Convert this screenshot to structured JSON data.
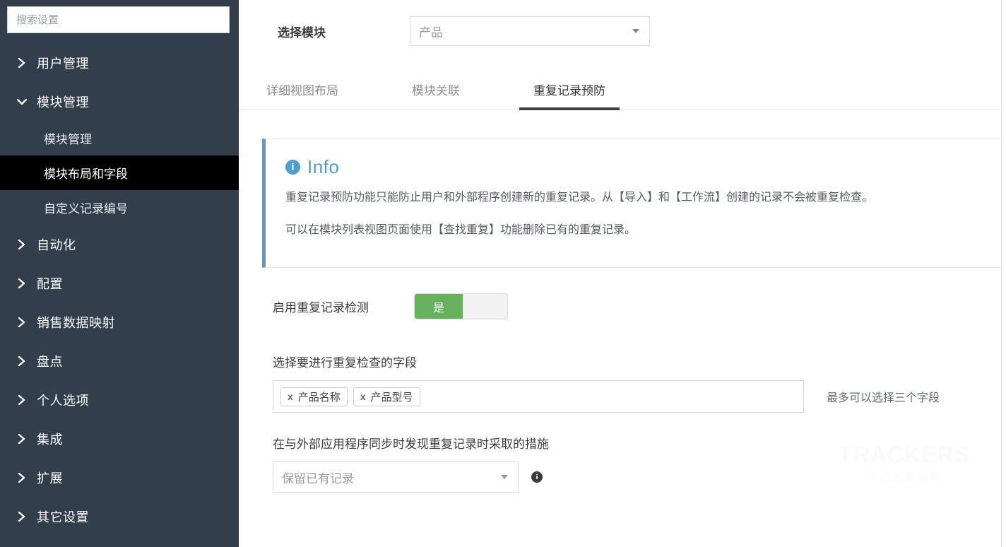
{
  "sidebar": {
    "search": {
      "placeholder": "搜索设置",
      "value": ""
    },
    "items": [
      {
        "label": "用户管理",
        "icon": "chevron-right-icon",
        "expanded": false
      },
      {
        "label": "模块管理",
        "icon": "chevron-down-icon",
        "expanded": true
      },
      {
        "label": "自动化",
        "icon": "chevron-right-icon",
        "expanded": false
      },
      {
        "label": "配置",
        "icon": "chevron-right-icon",
        "expanded": false
      },
      {
        "label": "销售数据映射",
        "icon": "chevron-right-icon",
        "expanded": false
      },
      {
        "label": "盘点",
        "icon": "chevron-right-icon",
        "expanded": false
      },
      {
        "label": "个人选项",
        "icon": "chevron-right-icon",
        "expanded": false
      },
      {
        "label": "集成",
        "icon": "chevron-right-icon",
        "expanded": false
      },
      {
        "label": "扩展",
        "icon": "chevron-right-icon",
        "expanded": false
      },
      {
        "label": "其它设置",
        "icon": "chevron-right-icon",
        "expanded": false
      }
    ],
    "submenu": [
      {
        "label": "模块管理",
        "active": false
      },
      {
        "label": "模块布局和字段",
        "active": true
      },
      {
        "label": "自定义记录编号",
        "active": false
      }
    ],
    "colors": {
      "background": "#333e4c",
      "active_background": "#000000",
      "text": "#ffffff"
    }
  },
  "main": {
    "module_picker": {
      "label": "选择模块",
      "selected": "产品",
      "caret_icon": "caret-down-icon"
    },
    "tabs": [
      {
        "label": "详细视图布局",
        "active": false
      },
      {
        "label": "模块关联",
        "active": false
      },
      {
        "label": "重复记录预防",
        "active": true
      }
    ],
    "info": {
      "icon": "info-circle-icon",
      "title": "Info",
      "accent_color": "#4e9fc9",
      "lines": [
        "重复记录预防功能只能防止用户和外部程序创建新的重复记录。从【导入】和【工作流】创建的记录不会被重复检查。",
        "可以在模块列表视图页面使用【查找重复】功能删除已有的重复记录。"
      ]
    },
    "enable_toggle": {
      "label": "启用重复记录检测",
      "on_label": "是",
      "state": "on",
      "on_color": "#66b05e"
    },
    "fields_section": {
      "label": "选择要进行重复检查的字段",
      "tags": [
        {
          "remove_icon": "x",
          "label": "产品名称"
        },
        {
          "remove_icon": "x",
          "label": "产品型号"
        }
      ],
      "hint": "最多可以选择三个字段"
    },
    "sync_action": {
      "label": "在与外部应用程序同步时发现重复记录时采取的措施",
      "selected": "保留已有记录",
      "caret_icon": "caret-down-icon",
      "help_icon": "info-circle-icon"
    },
    "watermark": {
      "line1": "TRACKERS",
      "line2": "产品信息管理"
    }
  }
}
